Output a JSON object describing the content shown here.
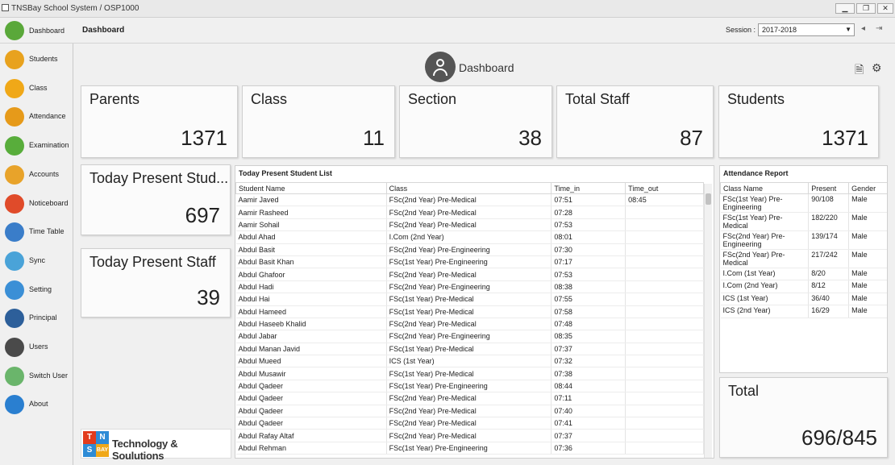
{
  "window": {
    "title": "TNSBay School System / OSP1000",
    "minimize": "▁",
    "restore": "❐",
    "close": "✕"
  },
  "topbar": {
    "nav_label": "Dashboard",
    "page_label": "Dashboard",
    "session_label": "Session :",
    "session_value": "2017-2018"
  },
  "sidebar": {
    "items": [
      {
        "label": "Students",
        "icon": "students-icon",
        "color": "#e8a21e"
      },
      {
        "label": "Class",
        "icon": "class-icon",
        "color": "#f0a818"
      },
      {
        "label": "Attendance",
        "icon": "attendance-icon",
        "color": "#e69a1a"
      },
      {
        "label": "Examination",
        "icon": "examination-icon",
        "color": "#58ad3b"
      },
      {
        "label": "Accounts",
        "icon": "accounts-icon",
        "color": "#e8a32a"
      },
      {
        "label": "Noticeboard",
        "icon": "noticeboard-icon",
        "color": "#e04b2a"
      },
      {
        "label": "Time Table",
        "icon": "timetable-icon",
        "color": "#3a7dc9"
      },
      {
        "label": "Sync",
        "icon": "sync-icon",
        "color": "#4aa3d8"
      },
      {
        "label": "Setting",
        "icon": "setting-icon",
        "color": "#3b8fd6"
      },
      {
        "label": "Principal",
        "icon": "principal-icon",
        "color": "#2d5f9a"
      },
      {
        "label": "Users",
        "icon": "users-icon",
        "color": "#4a4a4a"
      },
      {
        "label": "Switch User",
        "icon": "switch-user-icon",
        "color": "#6ab56b"
      },
      {
        "label": "About",
        "icon": "about-icon",
        "color": "#2a7fd0"
      }
    ]
  },
  "header": {
    "title": "Dashboard"
  },
  "cards": {
    "parents": {
      "title": "Parents",
      "value": "1371"
    },
    "class": {
      "title": "Class",
      "value": "11"
    },
    "section": {
      "title": "Section",
      "value": "38"
    },
    "total_staff": {
      "title": "Total Staff",
      "value": "87"
    },
    "students": {
      "title": "Students",
      "value": "1371"
    },
    "today_present_students": {
      "title": "Today Present Stud...",
      "value": "697"
    },
    "today_present_staff": {
      "title": "Today Present Staff",
      "value": "39"
    },
    "total": {
      "title": "Total",
      "value": "696/845"
    }
  },
  "student_list": {
    "title": "Today Present Student List",
    "columns": [
      "Student Name",
      "Class",
      "Time_in",
      "Time_out"
    ],
    "rows": [
      [
        "Aamir Javed",
        "FSc(2nd Year) Pre-Medical",
        "07:51",
        "08:45"
      ],
      [
        "Aamir Rasheed",
        "FSc(2nd Year) Pre-Medical",
        "07:28",
        ""
      ],
      [
        "Aamir Sohail",
        "FSc(2nd Year) Pre-Medical",
        "07:53",
        ""
      ],
      [
        "Abdul Ahad",
        "I.Com (2nd Year)",
        "08:01",
        ""
      ],
      [
        "Abdul Basit",
        "FSc(2nd Year) Pre-Engineering",
        "07:30",
        ""
      ],
      [
        "Abdul Basit Khan",
        "FSc(1st Year) Pre-Engineering",
        "07:17",
        ""
      ],
      [
        "Abdul Ghafoor",
        "FSc(2nd Year) Pre-Medical",
        "07:53",
        ""
      ],
      [
        "Abdul Hadi",
        "FSc(2nd Year) Pre-Engineering",
        "08:38",
        ""
      ],
      [
        "Abdul Hai",
        "FSc(1st Year) Pre-Medical",
        "07:55",
        ""
      ],
      [
        "Abdul Hameed",
        "FSc(1st Year) Pre-Medical",
        "07:58",
        ""
      ],
      [
        "Abdul Haseeb Khalid",
        "FSc(2nd Year) Pre-Medical",
        "07:48",
        ""
      ],
      [
        "Abdul Jabar",
        "FSc(2nd Year) Pre-Engineering",
        "08:35",
        ""
      ],
      [
        "Abdul Manan Javid",
        "FSc(1st Year) Pre-Medical",
        "07:37",
        ""
      ],
      [
        "Abdul Mueed",
        "ICS (1st Year)",
        "07:32",
        ""
      ],
      [
        "Abdul Musawir",
        "FSc(1st Year) Pre-Medical",
        "07:38",
        ""
      ],
      [
        "Abdul Qadeer",
        "FSc(1st Year) Pre-Engineering",
        "08:44",
        ""
      ],
      [
        "Abdul Qadeer",
        "FSc(2nd Year) Pre-Medical",
        "07:11",
        ""
      ],
      [
        "Abdul Qadeer",
        "FSc(2nd Year) Pre-Medical",
        "07:40",
        ""
      ],
      [
        "Abdul Qadeer",
        "FSc(2nd Year) Pre-Medical",
        "07:41",
        ""
      ],
      [
        "Abdul Rafay Altaf",
        "FSc(2nd Year) Pre-Medical",
        "07:37",
        ""
      ],
      [
        "Abdul Rehman",
        "FSc(1st Year) Pre-Engineering",
        "07:36",
        ""
      ]
    ]
  },
  "attendance_report": {
    "title": "Attendance Report",
    "columns": [
      "Class Name",
      "Present",
      "Gender"
    ],
    "rows": [
      [
        "FSc(1st Year) Pre-Engineering",
        "90/108",
        "Male"
      ],
      [
        "FSc(1st Year) Pre-Medical",
        "182/220",
        "Male"
      ],
      [
        "FSc(2nd Year) Pre-Engineering",
        "139/174",
        "Male"
      ],
      [
        "FSc(2nd Year) Pre-Medical",
        "217/242",
        "Male"
      ],
      [
        "I.Com (1st Year)",
        "8/20",
        "Male"
      ],
      [
        "I.Com (2nd Year)",
        "8/12",
        "Male"
      ],
      [
        "ICS (1st Year)",
        "36/40",
        "Male"
      ],
      [
        "ICS (2nd Year)",
        "16/29",
        "Male"
      ]
    ]
  },
  "logo": {
    "letters": [
      "T",
      "N",
      "S",
      "BAY"
    ],
    "text": "Technology & Soulutions"
  }
}
